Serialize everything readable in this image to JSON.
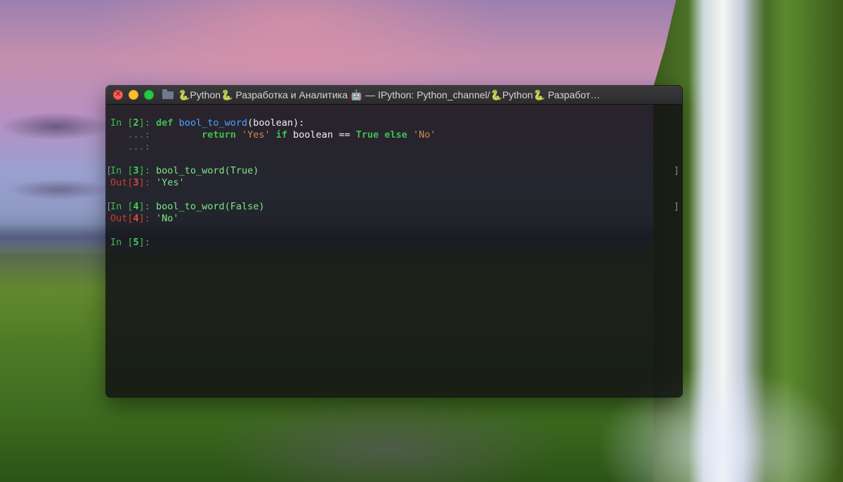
{
  "window": {
    "title": "🐍Python🐍 Разработка и Аналитика 🤖 — IPython: Python_channel/🐍Python🐍 Разработ…"
  },
  "console": {
    "cell2": {
      "prompt_in": "In [",
      "num": "2",
      "prompt_close": "]: ",
      "kw_def": "def",
      "fn_name": "bool_to_word",
      "params": "(boolean):",
      "cont1": "   ...: ",
      "indent": "        ",
      "kw_return": "return",
      "str_yes": "'Yes'",
      "kw_if": "if",
      "var_boolean": "boolean",
      "op_eq": "==",
      "kw_true": "True",
      "kw_else": "else",
      "str_no": "'No'",
      "cont2": "   ...: "
    },
    "cell3": {
      "prompt_in": "In [",
      "num": "3",
      "prompt_close": "]: ",
      "code": "bool_to_word(True)",
      "out_prefix": "Out[",
      "out_num": "3",
      "out_close": "]: ",
      "out_value": "'Yes'"
    },
    "cell4": {
      "prompt_in": "In [",
      "num": "4",
      "prompt_close": "]: ",
      "code": "bool_to_word(False)",
      "out_prefix": "Out[",
      "out_num": "4",
      "out_close": "]: ",
      "out_value": "'No'"
    },
    "cell5": {
      "prompt_in": "In [",
      "num": "5",
      "prompt_close": "]: "
    }
  },
  "icons": {
    "close": "close-icon",
    "minimize": "minimize-icon",
    "maximize": "maximize-icon",
    "folder": "folder-icon"
  },
  "colors": {
    "close": "#ff5f57",
    "minimize": "#febc2e",
    "maximize": "#28c840",
    "prompt_in": "#3fb950",
    "prompt_out": "#d23b2f",
    "keyword": "#3fbf4f",
    "function": "#4aa2ff",
    "string": "#d08a4a"
  }
}
